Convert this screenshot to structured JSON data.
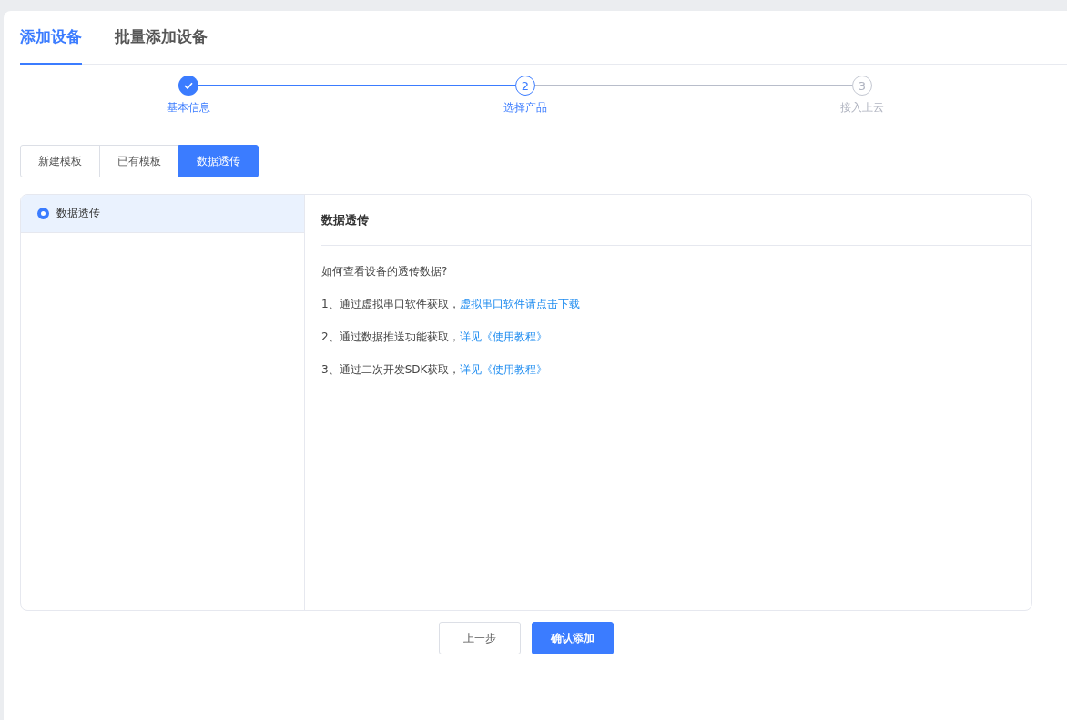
{
  "tabs": [
    {
      "label": "添加设备",
      "selected": true
    },
    {
      "label": "批量添加设备",
      "selected": false
    }
  ],
  "steps": [
    {
      "label": "基本信息",
      "kind": "done"
    },
    {
      "label": "选择产品",
      "number": "2",
      "kind": "active"
    },
    {
      "label": "接入上云",
      "number": "3",
      "kind": "wait"
    }
  ],
  "segments": [
    {
      "label": "新建模板",
      "selected": false
    },
    {
      "label": "已有模板",
      "selected": false
    },
    {
      "label": "数据透传",
      "selected": true
    }
  ],
  "options": [
    {
      "label": "数据透传",
      "selected": true
    }
  ],
  "detail": {
    "title": "数据透传",
    "intro": "如何查看设备的透传数据?",
    "lines": [
      {
        "text": "1、通过虚拟串口软件获取，",
        "link": "虚拟串口软件请点击下载"
      },
      {
        "text": "2、通过数据推送功能获取，",
        "link": "详见《使用教程》"
      },
      {
        "text": "3、通过二次开发SDK获取，",
        "link": "详见《使用教程》"
      }
    ]
  },
  "buttons": [
    {
      "label": "上一步",
      "kind": "secondary"
    },
    {
      "label": "确认添加",
      "kind": "primary"
    }
  ]
}
